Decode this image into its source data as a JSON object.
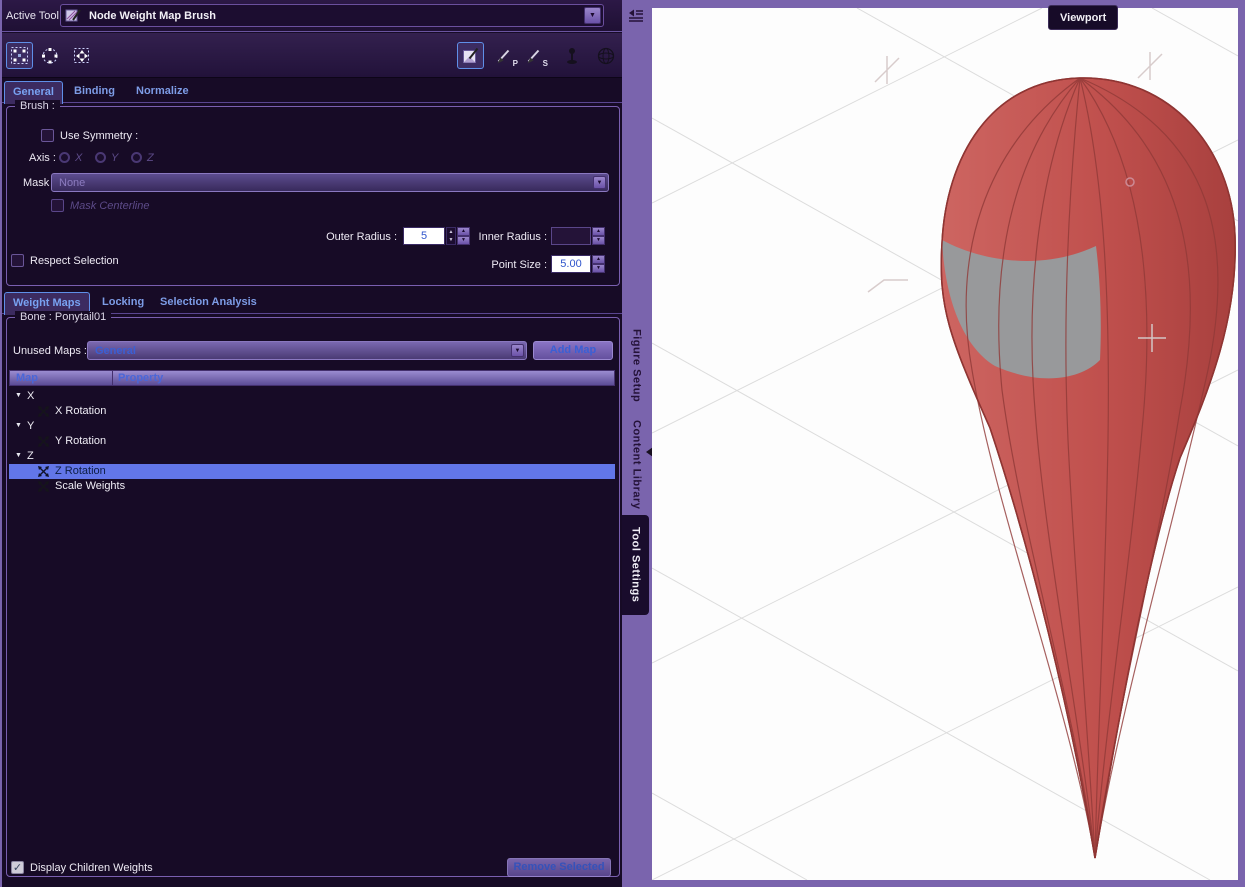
{
  "active_tool": {
    "label": "Active Tool :",
    "value": "Node Weight Map Brush"
  },
  "toolbar": {
    "brush_p_letter": "P",
    "brush_s_letter": "S"
  },
  "main_tabs": [
    {
      "label": "General"
    },
    {
      "label": "Binding"
    },
    {
      "label": "Normalize"
    }
  ],
  "brush_group": {
    "title": "Brush :",
    "use_symmetry_label": "Use Symmetry :",
    "axis_label": "Axis :",
    "axis_options": [
      "X",
      "Y",
      "Z"
    ],
    "mask_label": "Mask :",
    "mask_value": "None",
    "mask_centerline_label": "Mask Centerline",
    "outer_radius_label": "Outer Radius :",
    "outer_radius_value": "5",
    "inner_radius_label": "Inner Radius :",
    "inner_radius_value": "",
    "respect_selection_label": "Respect Selection",
    "point_size_label": "Point Size :",
    "point_size_value": "5.00"
  },
  "weight_tabs": [
    {
      "label": "Weight Maps"
    },
    {
      "label": "Locking"
    },
    {
      "label": "Selection Analysis"
    }
  ],
  "bone_group": {
    "title": "Bone : Ponytail01",
    "unused_maps_label": "Unused Maps :",
    "unused_maps_value": "General",
    "add_map_label": "Add Map",
    "columns": [
      "Map",
      "Property"
    ],
    "tree": [
      {
        "type": "group",
        "label": "X"
      },
      {
        "type": "item",
        "label": "X Rotation"
      },
      {
        "type": "group",
        "label": "Y"
      },
      {
        "type": "item",
        "label": "Y Rotation"
      },
      {
        "type": "group",
        "label": "Z"
      },
      {
        "type": "item",
        "label": "Z Rotation",
        "selected": true
      },
      {
        "type": "item",
        "label": "Scale Weights"
      }
    ],
    "display_children_label": "Display Children Weights",
    "remove_selected_label": "Remove Selected"
  },
  "side_tabs": [
    {
      "label": "Figure Setup"
    },
    {
      "label": "Content Library"
    },
    {
      "label": "Tool Settings",
      "active": true
    }
  ],
  "viewport": {
    "tab_label": "Viewport"
  },
  "icons": {
    "dropdown_arrow": "▼",
    "spinner_up": "▲",
    "spinner_down": "▼",
    "expander": "▼",
    "checkmark": "✓"
  },
  "colors": {
    "frame_purple": "#7a64ad",
    "panel_bg": "#170b26",
    "selection_blue": "#6276e8",
    "accent_blue_text": "#3b5fd4",
    "tab_text": "#7d9ce6",
    "object_red": "#c0504d",
    "object_gray": "#98999b",
    "viewport_bg": "#fdfdfd"
  }
}
